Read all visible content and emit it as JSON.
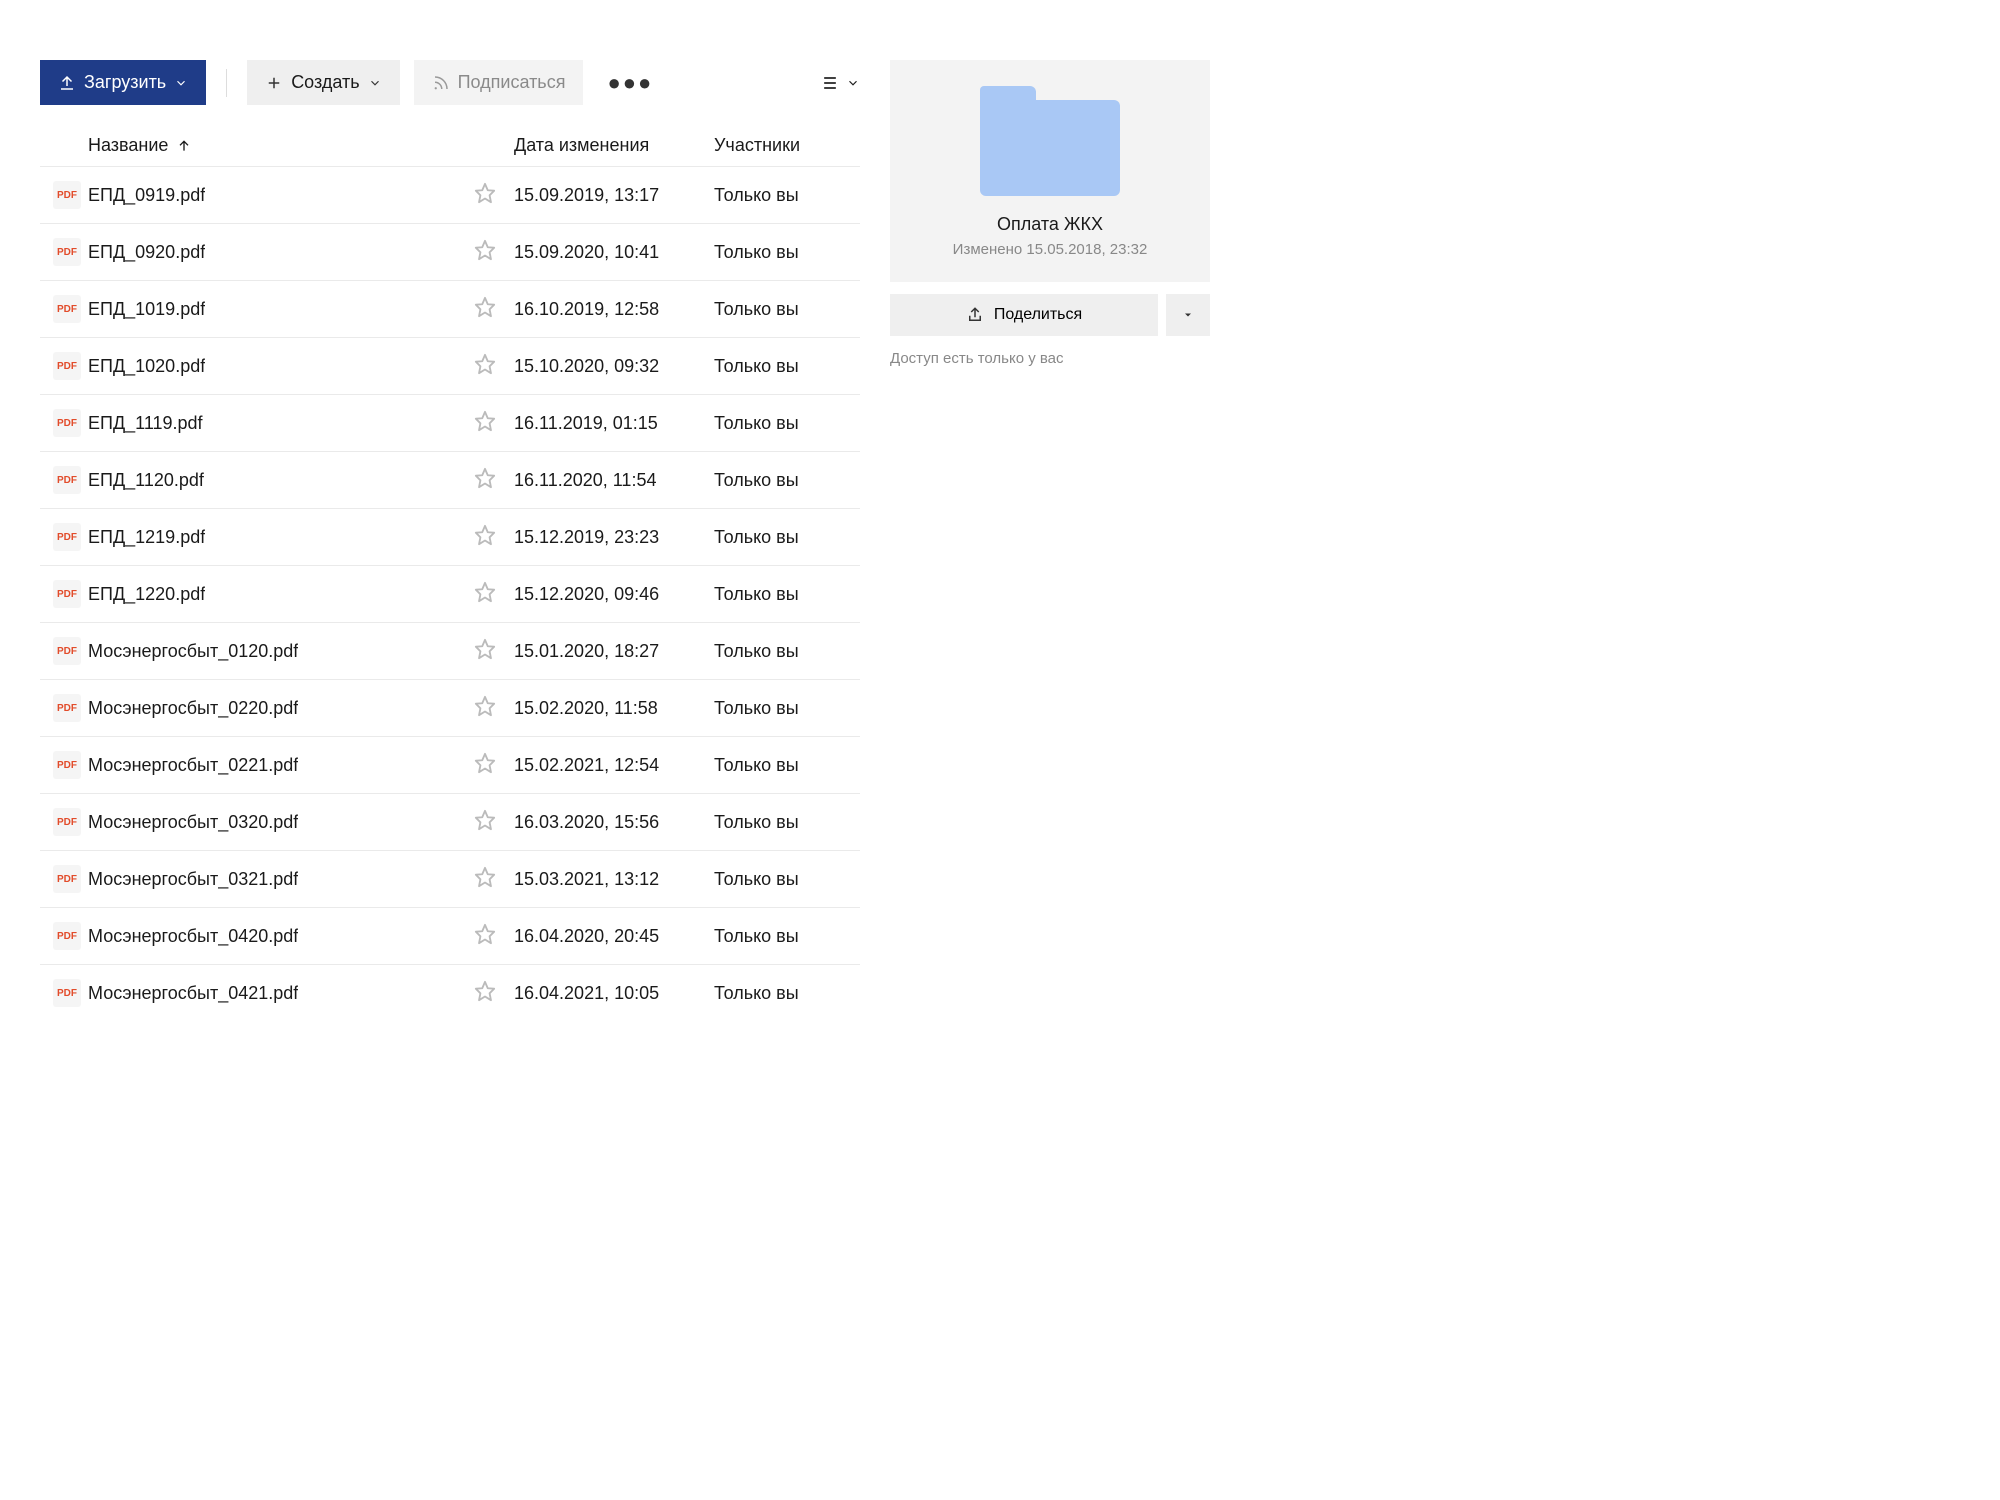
{
  "toolbar": {
    "upload_label": "Загрузить",
    "create_label": "Создать",
    "subscribe_label": "Подписаться"
  },
  "columns": {
    "name": "Название",
    "date": "Дата изменения",
    "participants": "Участники"
  },
  "files": [
    {
      "name": "ЕПД_0919.pdf",
      "date": "15.09.2019, 13:17",
      "participants": "Только вы",
      "badge": "PDF"
    },
    {
      "name": "ЕПД_0920.pdf",
      "date": "15.09.2020, 10:41",
      "participants": "Только вы",
      "badge": "PDF"
    },
    {
      "name": "ЕПД_1019.pdf",
      "date": "16.10.2019, 12:58",
      "participants": "Только вы",
      "badge": "PDF"
    },
    {
      "name": "ЕПД_1020.pdf",
      "date": "15.10.2020, 09:32",
      "participants": "Только вы",
      "badge": "PDF"
    },
    {
      "name": "ЕПД_1119.pdf",
      "date": "16.11.2019, 01:15",
      "participants": "Только вы",
      "badge": "PDF"
    },
    {
      "name": "ЕПД_1120.pdf",
      "date": "16.11.2020, 11:54",
      "participants": "Только вы",
      "badge": "PDF"
    },
    {
      "name": "ЕПД_1219.pdf",
      "date": "15.12.2019, 23:23",
      "participants": "Только вы",
      "badge": "PDF"
    },
    {
      "name": "ЕПД_1220.pdf",
      "date": "15.12.2020, 09:46",
      "participants": "Только вы",
      "badge": "PDF"
    },
    {
      "name": "Мосэнергосбыт_0120.pdf",
      "date": "15.01.2020, 18:27",
      "participants": "Только вы",
      "badge": "PDF"
    },
    {
      "name": "Мосэнергосбыт_0220.pdf",
      "date": "15.02.2020, 11:58",
      "participants": "Только вы",
      "badge": "PDF"
    },
    {
      "name": "Мосэнергосбыт_0221.pdf",
      "date": "15.02.2021, 12:54",
      "participants": "Только вы",
      "badge": "PDF"
    },
    {
      "name": "Мосэнергосбыт_0320.pdf",
      "date": "16.03.2020, 15:56",
      "participants": "Только вы",
      "badge": "PDF"
    },
    {
      "name": "Мосэнергосбыт_0321.pdf",
      "date": "15.03.2021, 13:12",
      "participants": "Только вы",
      "badge": "PDF"
    },
    {
      "name": "Мосэнергосбыт_0420.pdf",
      "date": "16.04.2020, 20:45",
      "participants": "Только вы",
      "badge": "PDF"
    },
    {
      "name": "Мосэнергосбыт_0421.pdf",
      "date": "16.04.2021, 10:05",
      "participants": "Только вы",
      "badge": "PDF"
    }
  ],
  "side": {
    "folder_name": "Оплата ЖКХ",
    "modified": "Изменено 15.05.2018, 23:32",
    "share_label": "Поделиться",
    "access_note": "Доступ есть только у вас"
  }
}
